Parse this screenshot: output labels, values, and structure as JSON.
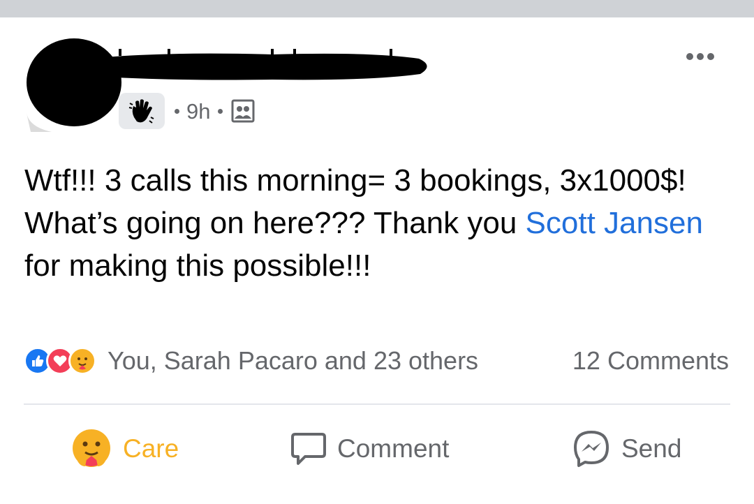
{
  "post": {
    "time": "9h",
    "text_part1": "Wtf!!! 3 calls this morning= 3 bookings, 3x1000$! What’s going on here??? Thank you ",
    "mention": "Scott Jansen",
    "text_part2": " for making this possible!!!"
  },
  "reactions": {
    "summary": "You, Sarah Pacaro and 23 others",
    "comments_count": "12 Comments",
    "icons": [
      "like-icon",
      "love-icon",
      "care-icon"
    ]
  },
  "actions": {
    "care_label": "Care",
    "comment_label": "Comment",
    "send_label": "Send"
  },
  "colors": {
    "mention": "#216fdb",
    "care": "#f7b125",
    "secondary_text": "#65676b",
    "like_blue": "#1877f2",
    "love_red": "#f33e58"
  }
}
